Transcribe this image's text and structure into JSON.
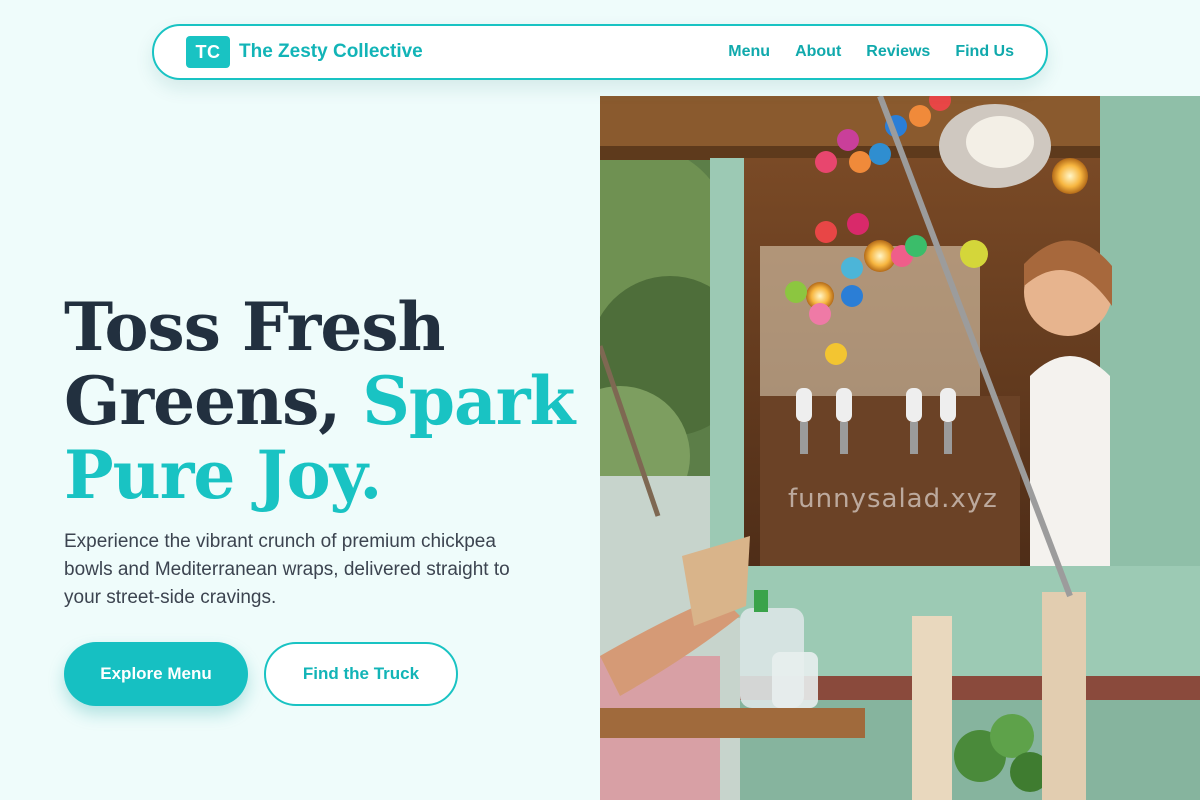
{
  "nav": {
    "logo_mark": "TC",
    "brand_name": "The Zesty Collective",
    "links": [
      "Menu",
      "About",
      "Reviews",
      "Find Us"
    ]
  },
  "hero": {
    "title_line1": "Toss Fresh",
    "title_line2_a": "Greens, ",
    "title_line2_b": "Spark",
    "title_line3": "Pure Joy.",
    "description": "Experience the vibrant crunch of premium chickpea bowls and Mediterranean wraps, delivered straight to your street-side cravings.",
    "primary_button": "Explore Menu",
    "secondary_button": "Find the Truck"
  },
  "photo": {
    "watermark": "funnysalad.xyz"
  },
  "colors": {
    "accent": "#19c3c3",
    "heading": "#22303f",
    "background": "#effcfb"
  }
}
